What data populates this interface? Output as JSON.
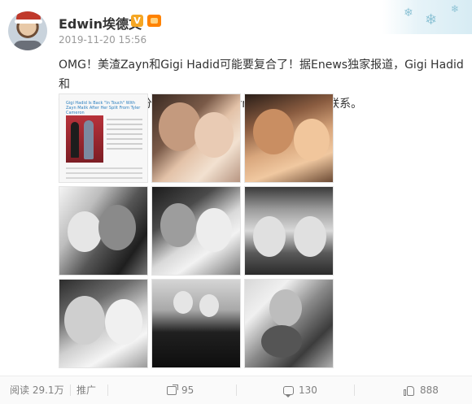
{
  "post": {
    "username": "Edwin埃德文",
    "verified_badge": "V",
    "timestamp": "2019-11-20 15:56",
    "text_line1": "OMG！美渣Zayn和Gigi Hadid可能要复合了！据Enews独家报道，Gigi Hadid和",
    "text_line2": "Tyler Cameron分手后，和美渣Zayn Malik又恢复了联系。",
    "article_headline": "Gigi Hadid Is Back \"In Touch\" With Zayn Malik After Her Split From Tyler Cameron"
  },
  "photos": [
    {
      "name": "article-screenshot"
    },
    {
      "name": "couple-selfie-1"
    },
    {
      "name": "couple-selfie-2"
    },
    {
      "name": "couple-bw-1"
    },
    {
      "name": "couple-bw-2"
    },
    {
      "name": "couple-bw-mirror"
    },
    {
      "name": "couple-bw-3"
    },
    {
      "name": "couple-bw-street"
    },
    {
      "name": "couple-bw-hug"
    }
  ],
  "actions": {
    "read_label": "阅读",
    "read_count": "29.1万",
    "promote_label": "推广",
    "forward_count": "95",
    "comment_count": "130",
    "like_count": "888"
  },
  "colors": {
    "username": "#333333",
    "verified": "#f5a623",
    "muted": "#999999"
  },
  "icons": [
    "forward-icon",
    "comment-icon",
    "like-icon",
    "snowflake-icon",
    "member-icon"
  ]
}
